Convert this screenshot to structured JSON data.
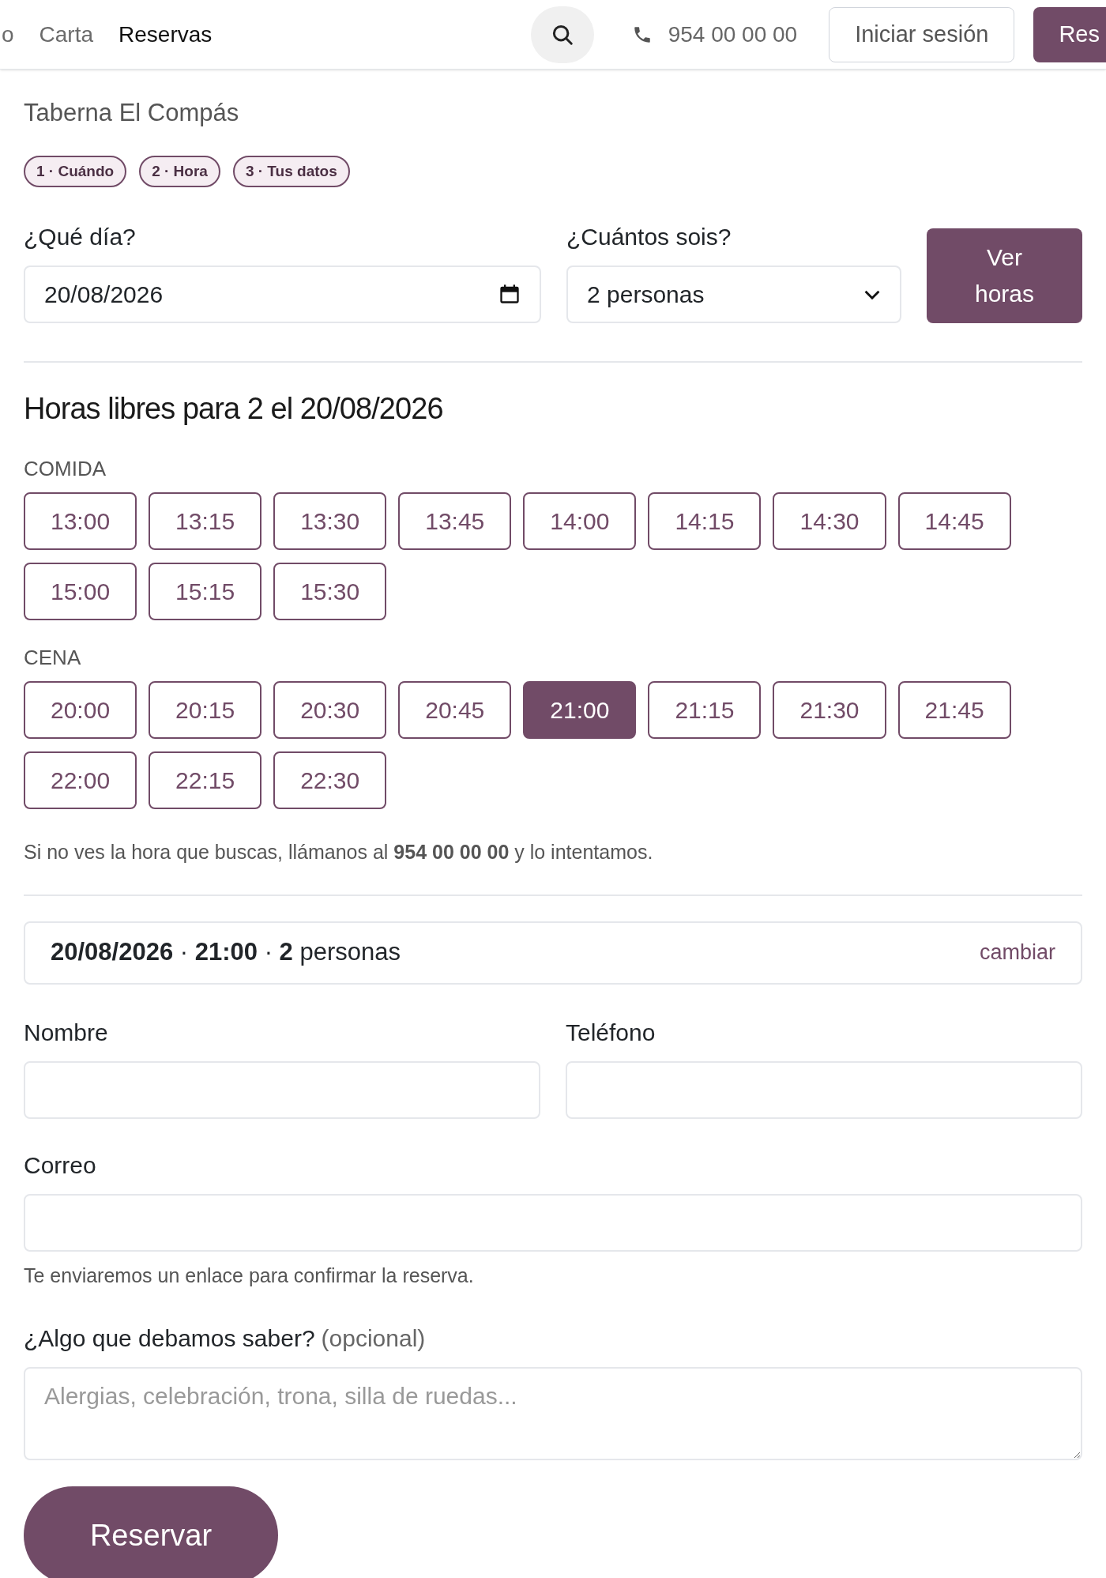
{
  "nav": {
    "links": [
      {
        "label": "o",
        "selected": false
      },
      {
        "label": "Carta",
        "selected": false
      },
      {
        "label": "Reservas",
        "selected": true
      }
    ],
    "phone": "954 00 00 00",
    "login": "Iniciar sesión",
    "cta": "Res"
  },
  "restaurant": "Taberna El Compás",
  "steps": [
    "1 · Cuándo",
    "2 · Hora",
    "3 · Tus datos"
  ],
  "search_form": {
    "date_label": "¿Qué día?",
    "date_value": "20/08/2026",
    "party_label": "¿Cuántos sois?",
    "party_value": "2 personas",
    "button": "Ver horas"
  },
  "slots_title": "Horas libres para 2 el 20/08/2026",
  "slot_groups": [
    {
      "name": "COMIDA",
      "slots": [
        {
          "time": "13:00",
          "selected": false
        },
        {
          "time": "13:15",
          "selected": false
        },
        {
          "time": "13:30",
          "selected": false
        },
        {
          "time": "13:45",
          "selected": false
        },
        {
          "time": "14:00",
          "selected": false
        },
        {
          "time": "14:15",
          "selected": false
        },
        {
          "time": "14:30",
          "selected": false
        },
        {
          "time": "14:45",
          "selected": false
        },
        {
          "time": "15:00",
          "selected": false
        },
        {
          "time": "15:15",
          "selected": false
        },
        {
          "time": "15:30",
          "selected": false
        }
      ]
    },
    {
      "name": "CENA",
      "slots": [
        {
          "time": "20:00",
          "selected": false
        },
        {
          "time": "20:15",
          "selected": false
        },
        {
          "time": "20:30",
          "selected": false
        },
        {
          "time": "20:45",
          "selected": false
        },
        {
          "time": "21:00",
          "selected": true
        },
        {
          "time": "21:15",
          "selected": false
        },
        {
          "time": "21:30",
          "selected": false
        },
        {
          "time": "21:45",
          "selected": false
        },
        {
          "time": "22:00",
          "selected": false
        },
        {
          "time": "22:15",
          "selected": false
        },
        {
          "time": "22:30",
          "selected": false
        }
      ]
    }
  ],
  "call_note": "Si no ves la hora que buscas, llámanos al **954 00 00 00** y lo intentamos.",
  "summary": {
    "text": "**20/08/2026** · **21:00** · **2** personas",
    "change": "cambiar"
  },
  "details": {
    "name_label": "Nombre",
    "phone_label": "Teléfono",
    "email_label": "Correo",
    "email_hint": "Te enviaremos un enlace para confirmar la reserva.",
    "notes_label": "¿Algo que debamos saber?",
    "notes_optional": "(opcional)",
    "notes_placeholder": "Alergias, celebración, trona, silla de ruedas..."
  },
  "submit": "Reservar"
}
